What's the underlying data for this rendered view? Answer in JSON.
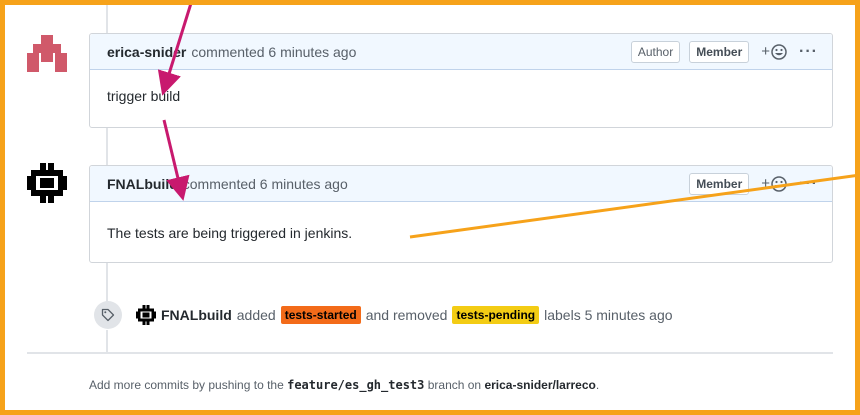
{
  "comments": [
    {
      "author": "erica-snider",
      "meta": "commented 6 minutes ago",
      "badges": [
        "Author",
        "Member"
      ],
      "body": "trigger build"
    },
    {
      "author": "FNALbuild",
      "meta": "commented 6 minutes ago",
      "badges": [
        "Member"
      ],
      "body": "The tests are being triggered in jenkins."
    }
  ],
  "event": {
    "actor": "FNALbuild",
    "added_text": "added",
    "label_added": "tests-started",
    "removed_text": "and removed",
    "label_removed": "tests-pending",
    "suffix": "labels 5 minutes ago",
    "label_added_color": "#f36b19",
    "label_removed_color": "#f3cc14"
  },
  "footer": {
    "prefix": "Add more commits by pushing to the",
    "branch": "feature/es_gh_test3",
    "middle": "branch on",
    "repo": "erica-snider/larreco",
    "suffix": "."
  },
  "reactions": {
    "plus": "+",
    "more": "···"
  },
  "colors": {
    "frame": "#f6a21a",
    "arrow_magenta": "#c8196e",
    "arrow_orange": "#f6a21a",
    "header_bg": "#f1f8ff"
  },
  "icons": [
    "user-identicon",
    "fermilab-logo-icon",
    "smiley-icon",
    "tag-icon",
    "kebab-icon"
  ]
}
